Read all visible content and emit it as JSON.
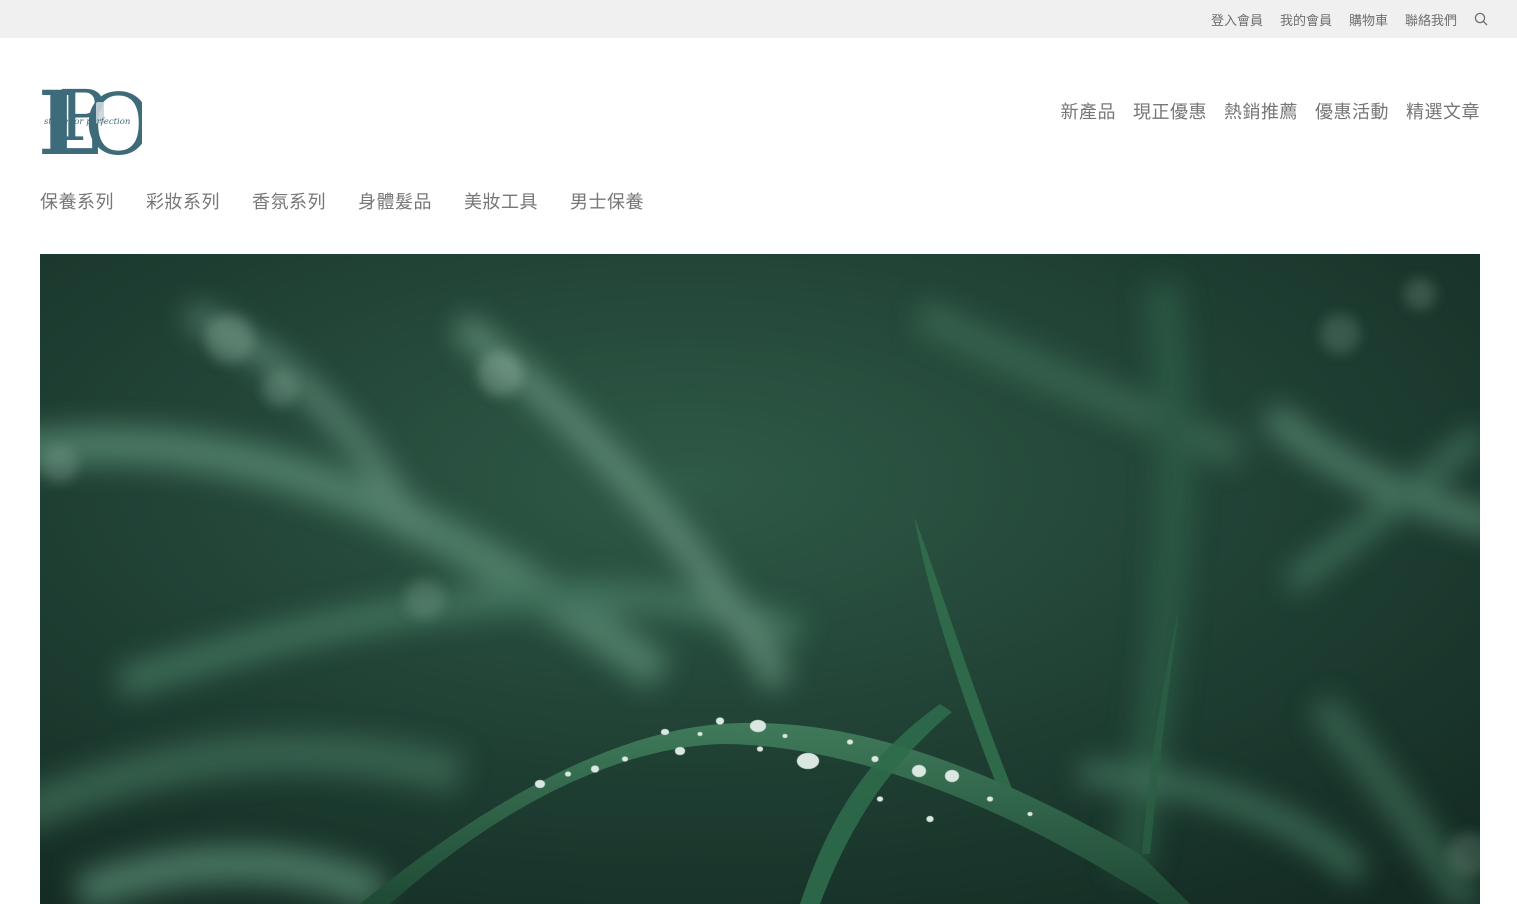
{
  "topbar": {
    "links": [
      {
        "label": "登入會員"
      },
      {
        "label": "我的會員"
      },
      {
        "label": "購物車"
      },
      {
        "label": "聯絡我們"
      }
    ],
    "search_icon": "search-icon"
  },
  "logo": {
    "letters_1": "L",
    "letters_2": "P",
    "letters_3": "O",
    "tagline": "strive for perfection",
    "color": "#3d6b7a"
  },
  "main_nav": {
    "items": [
      {
        "label": "新產品"
      },
      {
        "label": "現正優惠"
      },
      {
        "label": "熱銷推薦"
      },
      {
        "label": "優惠活動"
      },
      {
        "label": "精選文章"
      }
    ]
  },
  "category_nav": {
    "items": [
      {
        "label": "保養系列"
      },
      {
        "label": "彩妝系列"
      },
      {
        "label": "香氛系列"
      },
      {
        "label": "身體髮品"
      },
      {
        "label": "美妝工具"
      },
      {
        "label": "男士保養"
      }
    ]
  },
  "colors": {
    "topbar_bg": "#f1f0f1",
    "nav_text": "#777777",
    "hero_dark": "#1e3a2f",
    "hero_mid": "#2f6048",
    "hero_light": "#6f9c86"
  }
}
